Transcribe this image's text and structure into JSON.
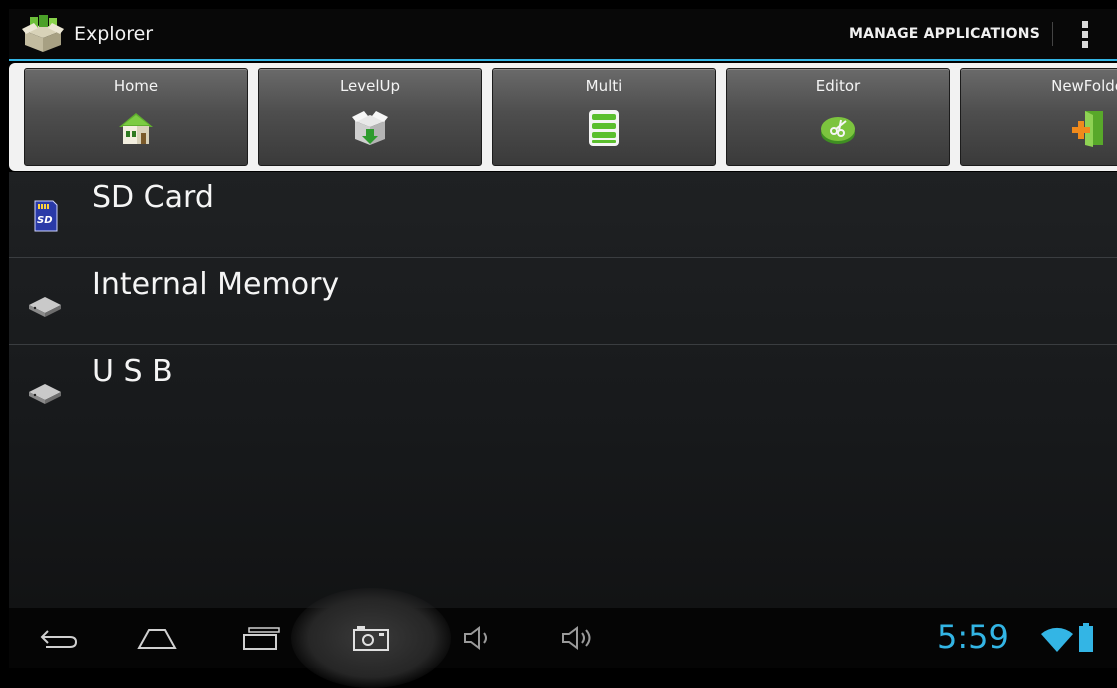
{
  "app": {
    "title": "Explorer",
    "icon": "explorer-box-icon"
  },
  "actionbar": {
    "manage_label": "MANAGE APPLICATIONS",
    "overflow_icon": "overflow-menu-icon",
    "accent_color": "#33b5e5"
  },
  "toolbar": {
    "buttons": [
      {
        "label": "Home",
        "icon": "home-icon"
      },
      {
        "label": "LevelUp",
        "icon": "level-up-icon"
      },
      {
        "label": "Multi",
        "icon": "multi-select-icon"
      },
      {
        "label": "Editor",
        "icon": "editor-icon"
      },
      {
        "label": "NewFolde",
        "icon": "new-folder-icon"
      }
    ]
  },
  "storage": {
    "items": [
      {
        "label": "SD Card",
        "icon": "sd-card-icon"
      },
      {
        "label": "Internal Memory",
        "icon": "drive-icon"
      },
      {
        "label": "U S B",
        "icon": "drive-icon"
      }
    ]
  },
  "navbar": {
    "buttons": [
      "back-icon",
      "home-outline-icon",
      "recent-apps-icon",
      "screenshot-icon",
      "volume-down-icon",
      "volume-up-icon"
    ],
    "time": "5:59",
    "status_icons": [
      "wifi-icon",
      "battery-icon"
    ],
    "time_color": "#33b5e5"
  }
}
